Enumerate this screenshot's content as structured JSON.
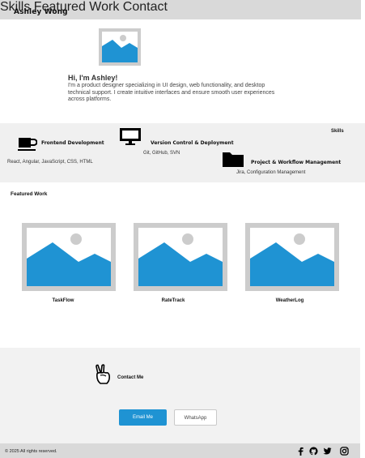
{
  "header": {
    "brand": "Ashley Wong",
    "nav": [
      "Skills",
      "Featured Work",
      "Contact"
    ]
  },
  "hero": {
    "image_icon": "image-placeholder-icon",
    "title": "Hi, I'm Ashley!",
    "text": " I'm a product designer specializing in UI design, web functionality, and desktop technical support. I create intuitive interfaces and ensure smooth user experiences across platforms."
  },
  "skills": {
    "title": "Skills",
    "items": [
      {
        "icon": "coffee-cup-icon",
        "name": "Frontend Development",
        "tech": "React, Angular, JavaScript, CSS, HTML"
      },
      {
        "icon": "monitor-icon",
        "name": "Version Control & Deployment",
        "tech": "Git, GitHub,  SVN"
      },
      {
        "icon": "folder-icon",
        "name": "Project & Workflow Management",
        "tech": "Jira, Configuration Management"
      }
    ]
  },
  "featured": {
    "title": "Featured Work",
    "projects": [
      {
        "name": "TaskFlow",
        "icon": "image-placeholder-icon"
      },
      {
        "name": "RateTrack",
        "icon": "image-placeholder-icon"
      },
      {
        "name": "WeatherLog",
        "icon": "image-placeholder-icon"
      }
    ]
  },
  "contact": {
    "icon": "peace-hand-icon",
    "title": "Contact Me",
    "email_label": "Email Me",
    "whatsapp_label": "WhatsApp"
  },
  "footer": {
    "copyright": "© 2025 All rights reserved.",
    "social": [
      "facebook-icon",
      "github-icon",
      "twitter-icon",
      "instagram-icon"
    ]
  },
  "colors": {
    "accent": "#1f93d3",
    "header_bg": "#d9d9d9",
    "section_bg": "#f0f0f0",
    "placeholder_frame": "#cccccc"
  }
}
